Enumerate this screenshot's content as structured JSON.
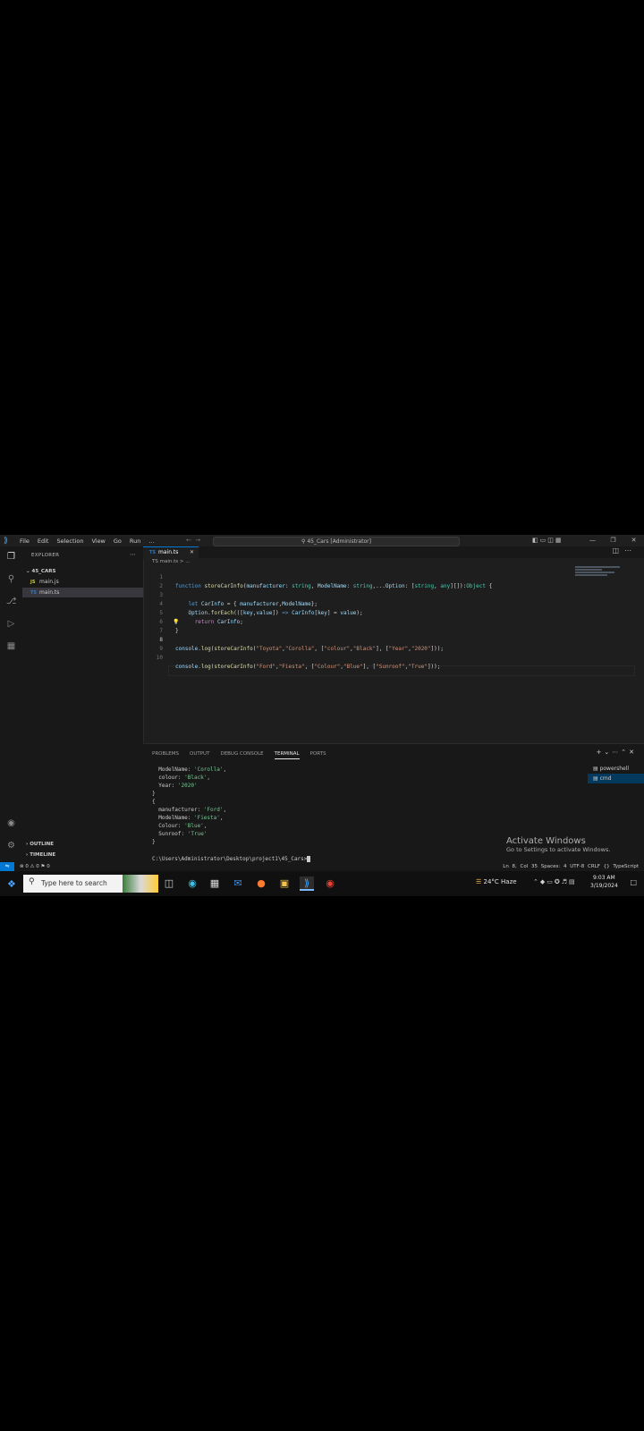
{
  "titlebar": {
    "menu": [
      "File",
      "Edit",
      "Selection",
      "View",
      "Go",
      "Run",
      "…"
    ],
    "command_center": "45_Cars [Administrator]"
  },
  "explorer": {
    "title": "EXPLORER",
    "folder": "45_CARS",
    "files": [
      {
        "icon": "JS",
        "name": "main.js"
      },
      {
        "icon": "TS",
        "name": "main.ts"
      }
    ],
    "outline": "OUTLINE",
    "timeline": "TIMELINE"
  },
  "editor": {
    "tab": {
      "icon": "TS",
      "name": "main.ts"
    },
    "breadcrumb": "TS main.ts > ...",
    "line_numbers": [
      "1",
      "2",
      "3",
      "4",
      "5",
      "6",
      "7",
      "8",
      "9",
      "10"
    ]
  },
  "panel": {
    "tabs": [
      "PROBLEMS",
      "OUTPUT",
      "DEBUG CONSOLE",
      "TERMINAL",
      "PORTS"
    ],
    "terminals": [
      "powershell",
      "cmd"
    ],
    "terminal_lines": [
      {
        "k": "  ModelName: ",
        "v": "'Corolla'",
        "e": ","
      },
      {
        "k": "  colour: ",
        "v": "'Black'",
        "e": ","
      },
      {
        "k": "  Year: ",
        "v": "'2020'",
        "e": ""
      },
      {
        "k": "}",
        "v": "",
        "e": ""
      },
      {
        "k": "{",
        "v": "",
        "e": ""
      },
      {
        "k": "  manufacturer: ",
        "v": "'Ford'",
        "e": ","
      },
      {
        "k": "  ModelName: ",
        "v": "'Fiesta'",
        "e": ","
      },
      {
        "k": "  Colour: ",
        "v": "'Blue'",
        "e": ","
      },
      {
        "k": "  Sunroof: ",
        "v": "'True'",
        "e": ""
      },
      {
        "k": "}",
        "v": "",
        "e": ""
      }
    ],
    "prompt": "C:\\Users\\Administrator\\Desktop\\project1\\45_Cars>",
    "watermark_title": "Activate Windows",
    "watermark_sub": "Go to Settings to activate Windows."
  },
  "statusbar": {
    "left": "⊗ 0 ⚠ 0   ⚑ 0",
    "right": "Ln 8, Col 35   Spaces: 4   UTF-8   CRLF   {} TypeScript"
  },
  "taskbar": {
    "search_placeholder": "Type here to search",
    "weather": "24°C  Haze",
    "time": "9:03 AM",
    "date": "3/19/2024"
  }
}
